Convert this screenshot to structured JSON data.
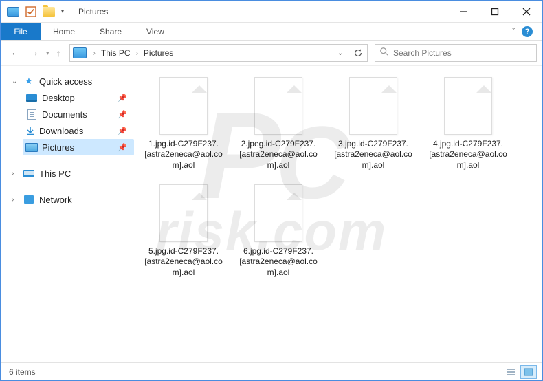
{
  "window": {
    "title": "Pictures"
  },
  "ribbon": {
    "file": "File",
    "tabs": [
      "Home",
      "Share",
      "View"
    ],
    "expand_hint": "ˇ"
  },
  "address": {
    "crumbs": [
      "This PC",
      "Pictures"
    ]
  },
  "search": {
    "placeholder": "Search Pictures"
  },
  "sidebar": {
    "quick": {
      "label": "Quick access",
      "items": [
        {
          "label": "Desktop",
          "pinned": true
        },
        {
          "label": "Documents",
          "pinned": true
        },
        {
          "label": "Downloads",
          "pinned": true
        },
        {
          "label": "Pictures",
          "pinned": true,
          "selected": true
        }
      ]
    },
    "thispc": {
      "label": "This PC"
    },
    "network": {
      "label": "Network"
    }
  },
  "files": [
    {
      "name": "1.jpg.id-C279F237.[astra2eneca@aol.com].aol"
    },
    {
      "name": "2.jpeg.id-C279F237.[astra2eneca@aol.com].aol"
    },
    {
      "name": "3.jpg.id-C279F237.[astra2eneca@aol.com].aol"
    },
    {
      "name": "4.jpg.id-C279F237.[astra2eneca@aol.com].aol"
    },
    {
      "name": "5.jpg.id-C279F237.[astra2eneca@aol.com].aol"
    },
    {
      "name": "6.jpg.id-C279F237.[astra2eneca@aol.com].aol"
    }
  ],
  "status": {
    "count_label": "6 items"
  },
  "watermark": {
    "line1_cap": "P",
    "line1_rest": "C",
    "line2": "risk.com"
  }
}
